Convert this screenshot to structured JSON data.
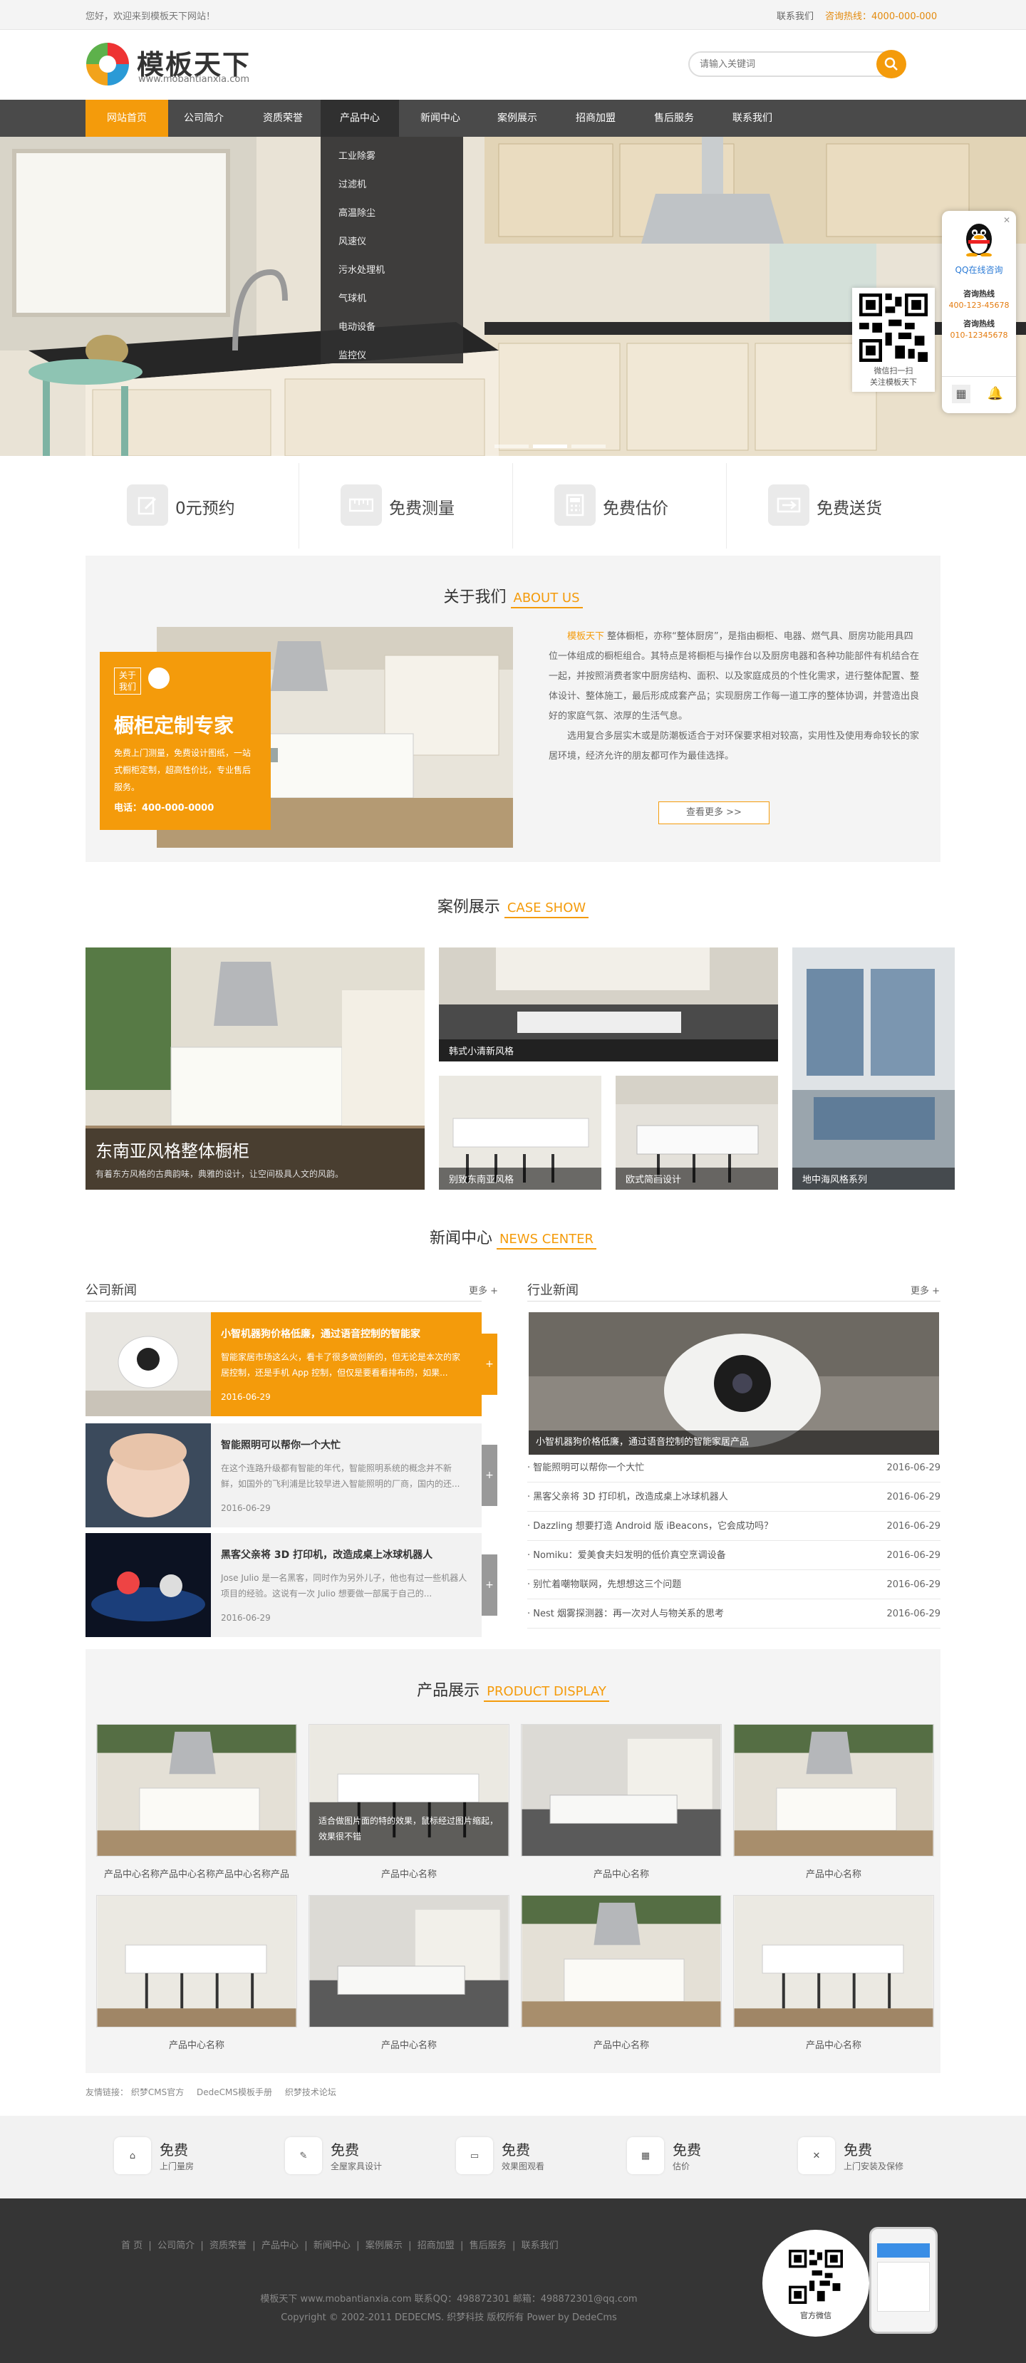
{
  "topbar": {
    "welcome": "您好，欢迎来到模板天下网站！",
    "contact": "联系我们",
    "hotline": "咨询热线：4000-000-000"
  },
  "logo": {
    "name": "模板天下",
    "url": "www.mobantianxia.com"
  },
  "search": {
    "placeholder": "请输入关键词"
  },
  "nav": [
    "网站首页",
    "公司简介",
    "资质荣誉",
    "产品中心",
    "新闻中心",
    "案例展示",
    "招商加盟",
    "售后服务",
    "联系我们"
  ],
  "dropdown": [
    "工业除雾",
    "过滤机",
    "高温除尘",
    "风速仪",
    "污水处理机",
    "气球机",
    "电动设备",
    "监控仪"
  ],
  "qq": {
    "online": "QQ在线咨询",
    "hot1_label": "咨询热线",
    "hot1": "400-123-45678",
    "hot2_label": "咨询热线",
    "hot2": "010-12345678",
    "qr_caption_1": "微信扫一扫",
    "qr_caption_2": "关注模板天下"
  },
  "services": [
    "0元预约",
    "免费测量",
    "免费估价",
    "免费送货"
  ],
  "about": {
    "title": "关于我们",
    "title_en": "ABOUT US",
    "box_tag1": "关于",
    "box_tag2": "我们",
    "box_title": "橱柜定制专家",
    "box_text": "免费上门测量，免费设计图纸，一站式橱柜定制，超高性价比，专业售后服务。",
    "box_tel": "电话：400-000-0000",
    "brand": "模板天下",
    "p1": "整体橱柜，亦称“整体厨房”，是指由橱柜、电器、燃气具、厨房功能用具四位一体组成的橱柜组合。其特点是将橱柜与操作台以及厨房电器和各种功能部件有机结合在一起，并按照消费者家中厨房结构、面积、以及家庭成员的个性化需求，进行整体配置、整体设计、整体施工，最后形成成套产品；实现厨房工作每一道工序的整体协调，并营造出良好的家庭气氛、浓厚的生活气息。",
    "p2": "选用复合多层实木或是防潮板适合于对环保要求相对较高，实用性及使用寿命较长的家居环境，经济允许的朋友都可作为最佳选择。",
    "more": "查看更多 >>"
  },
  "cases": {
    "title": "案例展示",
    "title_en": "CASE SHOW",
    "big_title": "东南亚风格整体橱柜",
    "big_desc": "有着东方风格的古典韵味，典雅的设计，让空间极具人文的风韵。",
    "items": [
      "韩式小清新风格",
      "别致东南亚风格",
      "欧式简画设计",
      "地中海风格系列"
    ]
  },
  "news": {
    "title": "新闻中心",
    "title_en": "NEWS CENTER",
    "company": "公司新闻",
    "industry": "行业新闻",
    "more": "更多 +",
    "items": [
      {
        "title": "小智机器狗价格低廉，通过语音控制的智能家",
        "desc": "智能家居市场这么火，看卡了很多做创新的，但无论是本次的家居控制，还是手机 App 控制，但仅是要看看排布的，如果...",
        "date": "2016-06-29"
      },
      {
        "title": "智能照明可以帮你一个大忙",
        "desc": "在这个连路升级都有智能的年代，智能照明系统的概念并不新鲜，如国外的飞利浦是比较早进入智能照明的厂商，国内的还...",
        "date": "2016-06-29"
      },
      {
        "title": "黑客父亲将 3D 打印机，改造成桌上冰球机器人",
        "desc": "Jose Julio 是一名黑客，同时作为另外儿子，他也有过一些机器人项目的经验。这说有一次 Julio 想要做一部属于自己的...",
        "date": "2016-06-29"
      }
    ],
    "feature_caption": "小智机器狗价格低廉，通过语音控制的智能家居产品",
    "list": [
      {
        "title": "· 智能照明可以帮你一个大忙",
        "date": "2016-06-29"
      },
      {
        "title": "· 黑客父亲将 3D 打印机，改造成桌上冰球机器人",
        "date": "2016-06-29"
      },
      {
        "title": "· Dazzling 想要打造 Android 版 iBeacons，它会成功吗？",
        "date": "2016-06-29"
      },
      {
        "title": "· Nomiku：爱美食夫妇发明的低价真空烹调设备",
        "date": "2016-06-29"
      },
      {
        "title": "· 别忙着嘲物联网，先想想这三个问题",
        "date": "2016-06-29"
      },
      {
        "title": "· Nest 烟雾探测器：再一次对人与物关系的思考",
        "date": "2016-06-29"
      }
    ]
  },
  "products": {
    "title": "产品展示",
    "title_en": "PRODUCT DISPLAY",
    "hover_caption": "适合做图片面的特的效果，鼠标经过图片缩起，效果很不错",
    "items": [
      "产品中心名称产品中心名称产品中心名称产品",
      "产品中心名称",
      "产品中心名称",
      "产品中心名称",
      "产品中心名称",
      "产品中心名称",
      "产品中心名称",
      "产品中心名称"
    ]
  },
  "links": {
    "label": "友情链接：",
    "items": [
      "织梦CMS官方",
      "DedeCMS模板手册",
      "织梦技术论坛"
    ]
  },
  "footer_services": [
    {
      "a": "免费",
      "b": "上门量房"
    },
    {
      "a": "免费",
      "b": "全屋家具设计"
    },
    {
      "a": "免费",
      "b": "效果图观看"
    },
    {
      "a": "免费",
      "b": "估价"
    },
    {
      "a": "免费",
      "b": "上门安装及保修"
    }
  ],
  "footer": {
    "nav": [
      "首 页",
      "公司简介",
      "资质荣誉",
      "产品中心",
      "新闻中心",
      "案例展示",
      "招商加盟",
      "售后服务",
      "联系我们"
    ],
    "line1": "模板天下 www.mobantianxia.com 联系QQ：498872301 邮箱：498872301@qq.com",
    "line2": "Copyright © 2002-2011 DEDECMS. 织梦科技 版权所有 Power by DedeCms",
    "wechat": "官方微信"
  },
  "colors": {
    "accent": "#f49b0b",
    "nav": "#4a4a4a",
    "footer": "#353535"
  }
}
